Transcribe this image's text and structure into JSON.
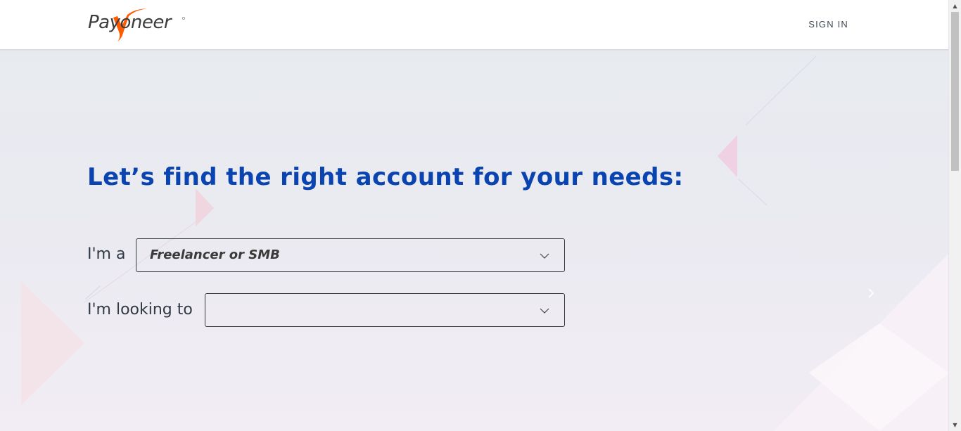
{
  "header": {
    "logo_text": "Payoneer",
    "sign_in_label": "SIGN IN"
  },
  "main": {
    "headline": "Let’s find the right account for your needs:",
    "role": {
      "label": "I'm a",
      "selected_value": "Freelancer or SMB"
    },
    "goal": {
      "label": "I'm looking to",
      "selected_value": ""
    }
  },
  "carousel": {
    "prev_icon": "chevron-left-icon",
    "next_icon": "chevron-right-icon"
  },
  "colors": {
    "headline": "#0a44b0",
    "logo_accent": "#ff5a00",
    "header_bg": "#ffffff"
  }
}
